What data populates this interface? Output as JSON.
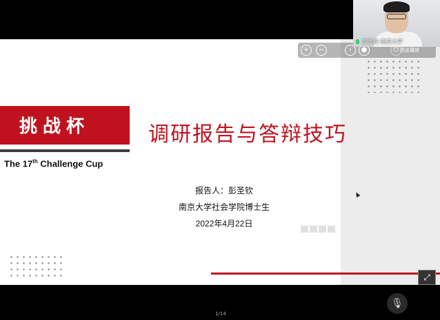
{
  "slide": {
    "banner_text": "挑战杯",
    "subtitle_pre": "The 17",
    "subtitle_sup": "th",
    "subtitle_post": " Challenge Cup",
    "main_title": "调研报告与答辩技巧",
    "reporter": "报告人：彭圣钦",
    "affiliation": "南京大学社会学院博士生",
    "date": "2022年4月22日"
  },
  "video": {
    "participant_name": "彭圣钦-南京大学"
  },
  "toolbar": {
    "zoom_in_icon": "zoom-in-icon",
    "zoom_out_icon": "zoom-out-icon",
    "exit_label": "退出播放"
  },
  "footer": {
    "page_indicator": "1/14"
  },
  "colors": {
    "accent_red": "#c0121e",
    "background": "#000000"
  }
}
